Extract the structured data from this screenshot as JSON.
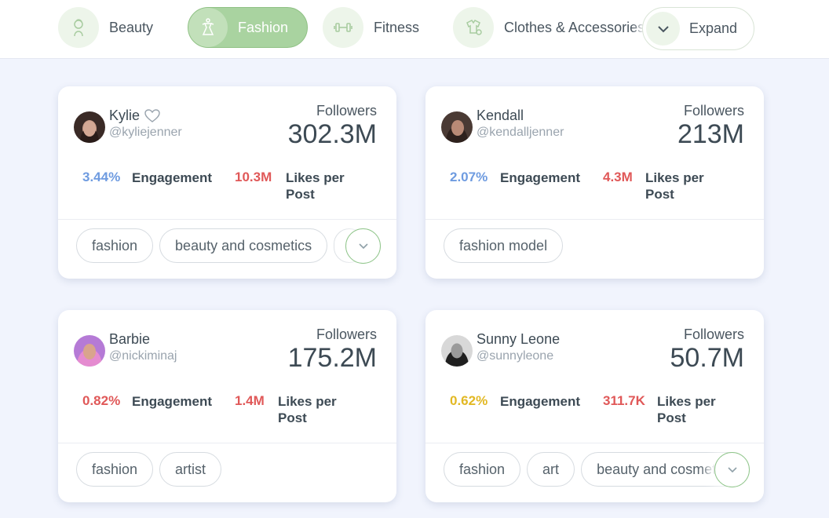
{
  "categories": [
    {
      "label": "Beauty",
      "icon": "beauty-icon",
      "active": false
    },
    {
      "label": "Fashion",
      "icon": "fashion-icon",
      "active": true
    },
    {
      "label": "Fitness",
      "icon": "fitness-icon",
      "active": false
    },
    {
      "label": "Clothes & Accessories",
      "icon": "clothes-accessories-icon",
      "active": false
    }
  ],
  "expand_label": "Expand",
  "colors": {
    "accent_green": "#a9d3a0",
    "rate_blue": "#6e9be0",
    "rate_red": "#e05858",
    "rate_yellow": "#e2b823",
    "likes_red": "#e05858"
  },
  "influencers": [
    {
      "name": "Kylie",
      "handle": "@kyliejenner",
      "favorite_icon": "heart-outline-icon",
      "followers_label": "Followers",
      "followers": "302.3M",
      "engagement": "3.44%",
      "engagement_label": "Engagement",
      "likes": "10.3M",
      "likes_label": "Likes per Post",
      "tags": [
        "fashion",
        "beauty and cosmetics"
      ],
      "more_tags": true
    },
    {
      "name": "Kendall",
      "handle": "@kendalljenner",
      "followers_label": "Followers",
      "followers": "213M",
      "engagement": "2.07%",
      "engagement_label": "Engagement",
      "likes": "4.3M",
      "likes_label": "Likes per Post",
      "tags": [
        "fashion model"
      ],
      "more_tags": false
    },
    {
      "name": "Barbie",
      "handle": "@nickiminaj",
      "followers_label": "Followers",
      "followers": "175.2M",
      "engagement": "0.82%",
      "engagement_label": "Engagement",
      "likes": "1.4M",
      "likes_label": "Likes per Post",
      "tags": [
        "fashion",
        "artist"
      ],
      "more_tags": false
    },
    {
      "name": "Sunny Leone",
      "handle": "@sunnyleone",
      "followers_label": "Followers",
      "followers": "50.7M",
      "engagement": "0.62%",
      "engagement_label": "Engagement",
      "likes": "311.7K",
      "likes_label": "Likes per Post",
      "tags": [
        "fashion",
        "art",
        "beauty and cosmetics"
      ],
      "more_tags": true
    }
  ]
}
